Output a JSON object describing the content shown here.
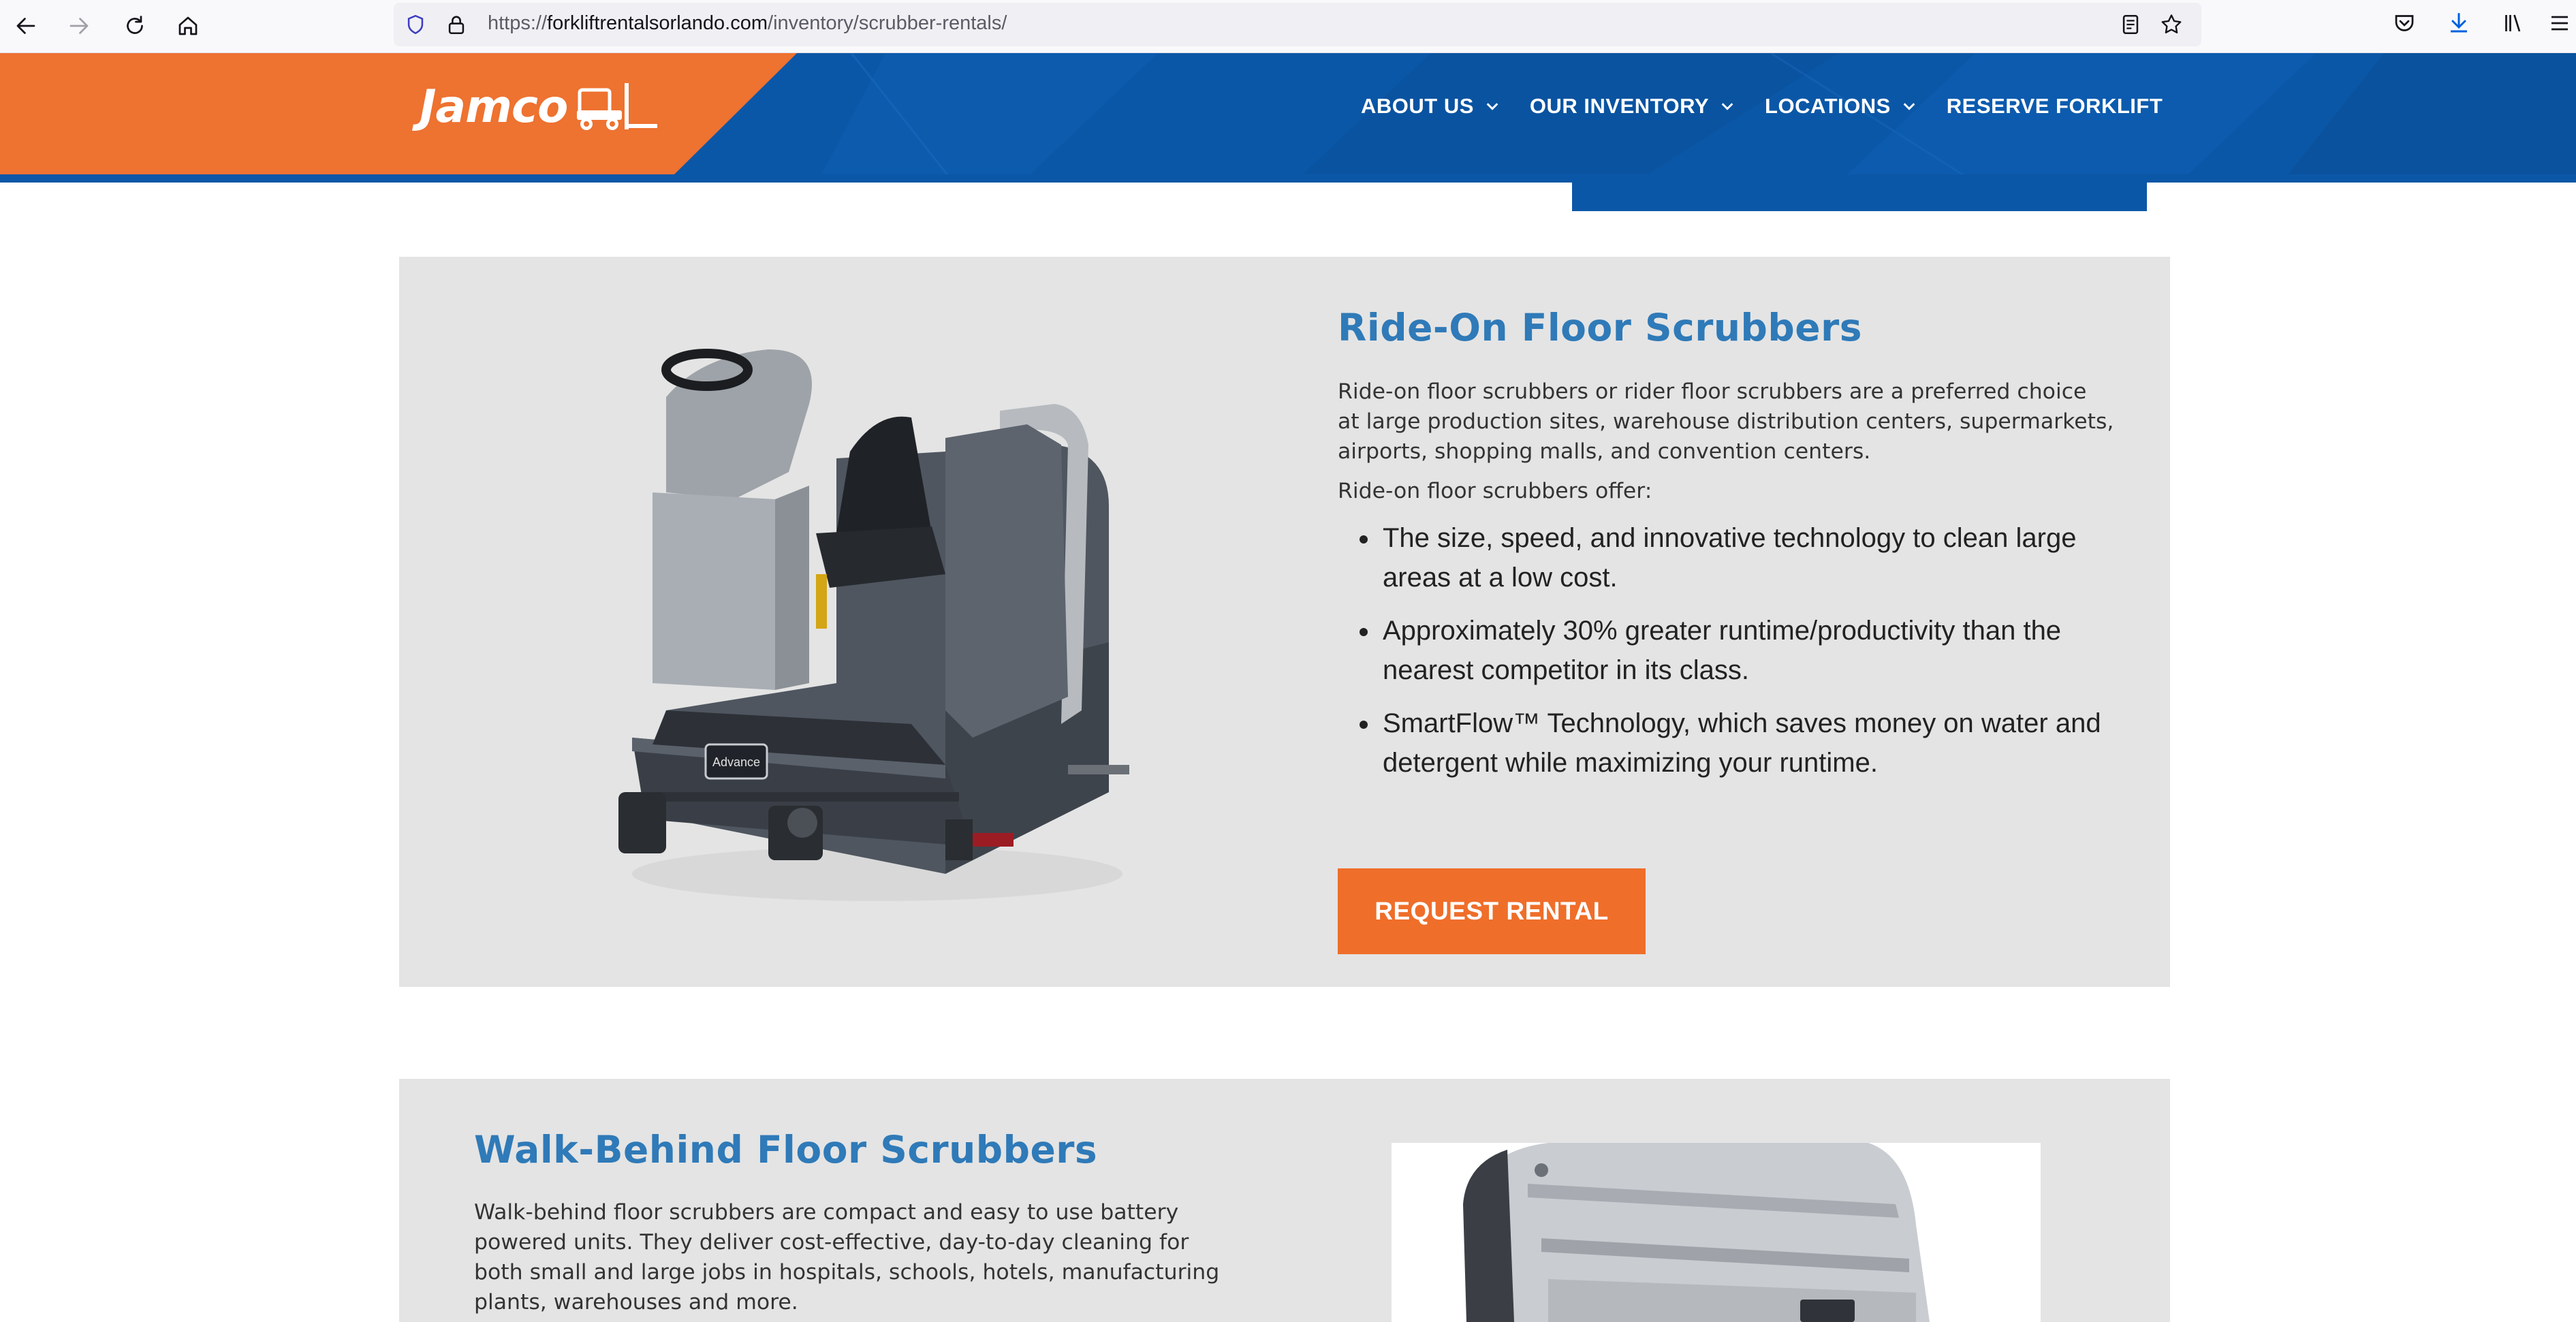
{
  "browser": {
    "url_scheme": "https://",
    "url_host": "forkliftrentalsorlando.com",
    "url_path": "/inventory/scrubber-rentals/"
  },
  "header": {
    "logo_text": "Jamco",
    "nav": [
      {
        "label": "ABOUT US",
        "has_dropdown": true
      },
      {
        "label": "OUR INVENTORY",
        "has_dropdown": true
      },
      {
        "label": "LOCATIONS",
        "has_dropdown": true
      },
      {
        "label": "RESERVE FORKLIFT",
        "has_dropdown": false
      }
    ]
  },
  "ride_on": {
    "title": "Ride-On Floor Scrubbers",
    "intro": "Ride-on floor scrubbers or rider floor scrubbers are a preferred choice at large production sites, warehouse distribution centers, supermarkets, airports, shopping malls, and convention centers.",
    "offer_label": "Ride-on floor scrubbers offer:",
    "bullets": [
      "The size, speed, and innovative technology to clean large areas at a low cost.",
      "Approximately 30% greater runtime/productivity than the nearest competitor in its class.",
      "SmartFlow™ Technology, which saves money on water and detergent while maximizing your runtime."
    ],
    "button_label": "REQUEST RENTAL",
    "image_brand_label": "Advance"
  },
  "walk_behind": {
    "title": "Walk-Behind Floor Scrubbers",
    "intro": "Walk-behind floor scrubbers are compact and easy to use battery powered units. They deliver cost-effective, day-to-day cleaning for both small and large jobs in hospitals, schools, hotels, manufacturing plants, warehouses and more."
  },
  "colors": {
    "brand_orange": "#ee7230",
    "brand_blue": "#0b57a7",
    "title_blue": "#2f7ab8",
    "button_orange": "#ef6e2a",
    "section_bg": "#e4e4e4"
  }
}
